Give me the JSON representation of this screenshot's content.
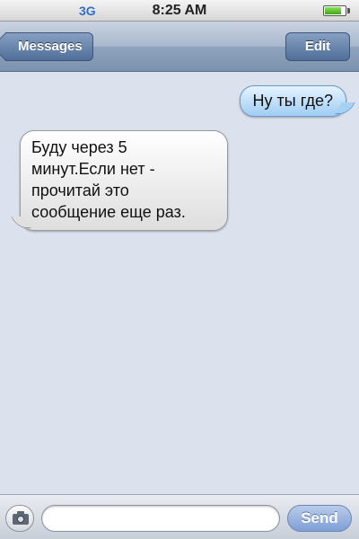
{
  "status_bar": {
    "network": "3G",
    "time": "8:25 AM",
    "battery_level": 0.85
  },
  "nav_bar": {
    "back_label": "Messages",
    "edit_label": "Edit"
  },
  "messages": [
    {
      "direction": "outgoing",
      "text": "Ну ты где?"
    },
    {
      "direction": "incoming",
      "text": "Буду через 5 минут.Если нет - прочитай это сообщение еще раз."
    }
  ],
  "input_bar": {
    "placeholder": "",
    "value": "",
    "send_label": "Send",
    "camera_icon": "camera-icon"
  },
  "colors": {
    "background": "#dbe2ed",
    "nav_bar": "#8ea3bd",
    "outgoing_bubble": "#9fcdf3",
    "incoming_bubble": "#ffffff",
    "network_text": "#2f6fc9"
  }
}
